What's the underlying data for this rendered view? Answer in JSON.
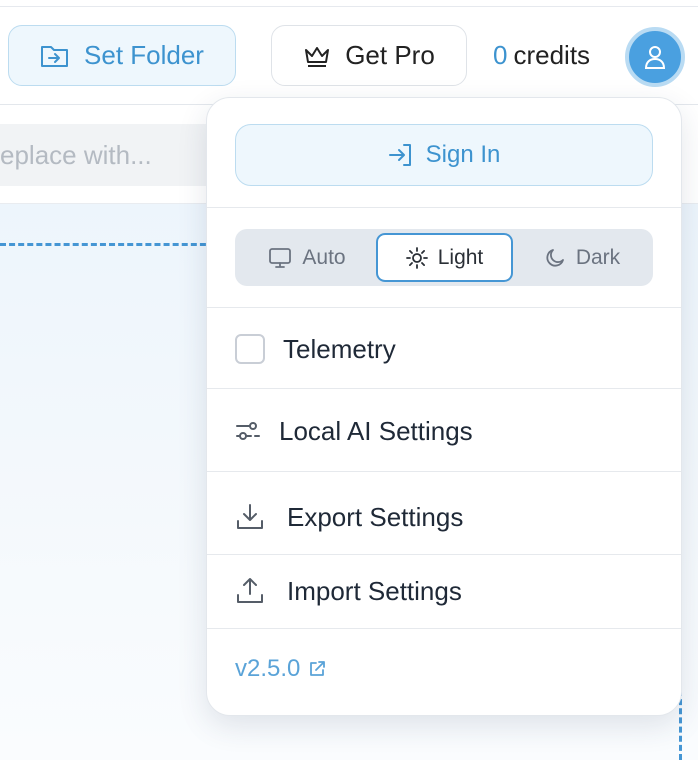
{
  "header": {
    "set_folder_label": "Set Folder",
    "get_pro_label": "Get Pro",
    "credits_count": "0",
    "credits_label": "credits"
  },
  "search": {
    "replace_placeholder": "eplace with..."
  },
  "user_menu": {
    "sign_in_label": "Sign In",
    "theme_options": [
      "Auto",
      "Light",
      "Dark"
    ],
    "selected_theme": "Light",
    "telemetry_label": "Telemetry",
    "telemetry_checked": false,
    "local_ai_label": "Local AI Settings",
    "export_label": "Export Settings",
    "import_label": "Import Settings",
    "version": "v2.5.0"
  },
  "colors": {
    "accent": "#4596d4",
    "accent_text": "#3d93cf",
    "accent_bg": "#eef7fd"
  },
  "icons": [
    "folder-import-icon",
    "crown-icon",
    "user-icon",
    "sign-in-icon",
    "monitor-icon",
    "sun-icon",
    "moon-icon",
    "sliders-icon",
    "download-icon",
    "upload-icon",
    "external-link-icon"
  ]
}
